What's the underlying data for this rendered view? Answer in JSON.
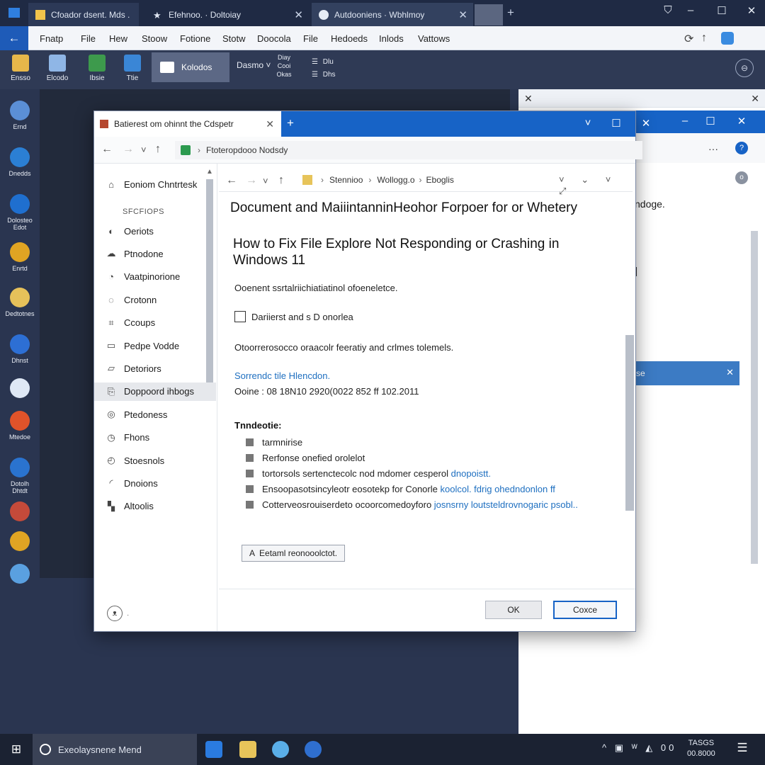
{
  "browser": {
    "tabs": [
      {
        "label": "Cfoador dsent. Mds ."
      },
      {
        "label": "Efehnoo. · Doltoiay"
      },
      {
        "label": "Autdooniens · Wbhlmoy"
      }
    ],
    "window_controls": {
      "minimize": "–",
      "maximize": "☐",
      "close": "✕"
    }
  },
  "menubar": {
    "back": "←",
    "items": [
      "Fnatp",
      "File",
      "Hew",
      "Stoow",
      "Fotione",
      "Stotw",
      "Doocola",
      "File",
      "Hedoeds",
      "Inlods",
      "Vattows"
    ]
  },
  "ribbon": {
    "buttons": [
      {
        "label": "Ensso",
        "color": "#e7b74a"
      },
      {
        "label": "Elcodo",
        "color": "#8fb6e6"
      },
      {
        "label": "Ibsie",
        "color": "#3d9a4c"
      },
      {
        "label": "Ttie",
        "color": "#3a86d6"
      }
    ],
    "active": {
      "label": "Kolodos"
    },
    "dropdown": "Dasmo ˅",
    "small_groups": [
      {
        "line1": "Diay",
        "line2": "Cooi",
        "line3": "Okas"
      },
      {
        "line1": "Dlu",
        "line2": "Dhs"
      }
    ]
  },
  "desktop": {
    "icons": [
      {
        "label": "Ernd",
        "color": "#5b8fd6"
      },
      {
        "label": "Dnedds",
        "color": "#2b7fd4"
      },
      {
        "label": "Dolosteo Edot",
        "color": "#1f6fcf"
      },
      {
        "label": "Enrtd",
        "color": "#e0a423"
      },
      {
        "label": "Dedtotnes",
        "color": "#e6c15a"
      },
      {
        "label": "Dhnst",
        "color": "#2d6fd4"
      },
      {
        "label": "",
        "color": "#dfe8f5"
      },
      {
        "label": "Mtedoe",
        "color": "#e0532a"
      },
      {
        "label": "Dotolh Dhtdt",
        "color": "#2a73cf"
      },
      {
        "label": "",
        "color": "#c44a3a"
      },
      {
        "label": "",
        "color": "#e0a423"
      },
      {
        "label": "",
        "color": "#5aa0e0"
      }
    ]
  },
  "bg_window": {
    "close_left": "✕",
    "close_right": "✕",
    "more": "···",
    "info": "?",
    "grey_badge": "o",
    "text1": "ndoge.",
    "text2": "]",
    "banner": "se",
    "banner_close": "✕"
  },
  "main_window": {
    "tab_title": "Batierest om ohinnt the Cdspetr",
    "tab_close": "✕",
    "new_tab": "+",
    "controls": {
      "dropdown": "˅",
      "restore": "☐",
      "close": "✕"
    },
    "address": "Ftoteropdooo Nodsdy",
    "nav": {
      "back": "←",
      "forward": "→",
      "down": "˅",
      "up": "↑",
      "separator": "›"
    },
    "sidebar": {
      "header": "SFCFIOPS",
      "items": [
        {
          "label": "Eoniom Chntrtesk",
          "icon": "⌂"
        },
        {
          "label": "Oeriots",
          "icon": "◐"
        },
        {
          "label": "Ptnodone",
          "icon": "☁"
        },
        {
          "label": "Vaatpinorione",
          "icon": "◔"
        },
        {
          "label": "Crotonn",
          "icon": "◌"
        },
        {
          "label": "Ccoups",
          "icon": "⌗"
        },
        {
          "label": "Pedpe Vodde",
          "icon": "▭"
        },
        {
          "label": "Detoriors",
          "icon": "▱"
        },
        {
          "label": "Doppoord ihbogs",
          "icon": "⎘"
        },
        {
          "label": "Ptedoness",
          "icon": "◎"
        },
        {
          "label": "Fhons",
          "icon": "◷"
        },
        {
          "label": "Stoesnols",
          "icon": "◴"
        },
        {
          "label": "Dnoions",
          "icon": "◜"
        },
        {
          "label": "Altoolis",
          "icon": "▚"
        }
      ],
      "footer_icon": "ᴥ"
    },
    "inner_nav": {
      "path_a": "Stennioo",
      "path_b": "Wollogg.o",
      "path_c": "Eboglis",
      "separator": "›",
      "tools": "˅ ⌄ ˅ ⤢"
    },
    "content": {
      "doc_title": "Document and MaiiintanninHeohor Forpoer for or Whetery",
      "article_title": "How to Fix File Explore Not Responding or Crashing in Windows 11",
      "intro": "Ooenent ssrtalriichiatiatinol ofoeneletce.",
      "checkbox_label": "Dariierst and s D onorlea",
      "body_para": "Otoorrerosocco oraacolr feeratiy  and crlmes tolemels.",
      "link": "Sorrendc tile Hlencdon.",
      "date_line": "Ooine  :  08 18N10 2920(0022 852 ff 102.2011",
      "section_heading": "Tnndeotie:",
      "bullets": [
        {
          "text": "tarmnirise",
          "link": ""
        },
        {
          "text": "Rerfonse onefied orolelot",
          "link": ""
        },
        {
          "text": "tortorsols sertenctecolc nod mdomer cesperol ",
          "link": "dnopoistt."
        },
        {
          "text": "Ensoopasotsincyleotr eosotekp for Conorle ",
          "link": "koolcol. fdrig ohedndonlon ff"
        },
        {
          "text": "Cotterveosrouiserdeto ocoorcomedoyforo ",
          "link": "josnsrny loutsteldrovnogaric psobl.."
        }
      ],
      "feedback_icon": "A",
      "feedback_label": "Eetaml reonooolctot."
    },
    "footer": {
      "ok": "OK",
      "close": "Coxce"
    }
  },
  "taskbar": {
    "start": "⊞",
    "search": "Exeolaysnene Mend",
    "apps": [
      {
        "color": "#2a7be0"
      },
      {
        "color": "#e7c45a"
      },
      {
        "color": "#5aaee8"
      },
      {
        "color": "#2f6fcf"
      }
    ],
    "tray": "^ ▣ ᵂ ◭ 00",
    "clock_time": "TASGS",
    "clock_date": "00.8000",
    "notifications": "☰"
  }
}
